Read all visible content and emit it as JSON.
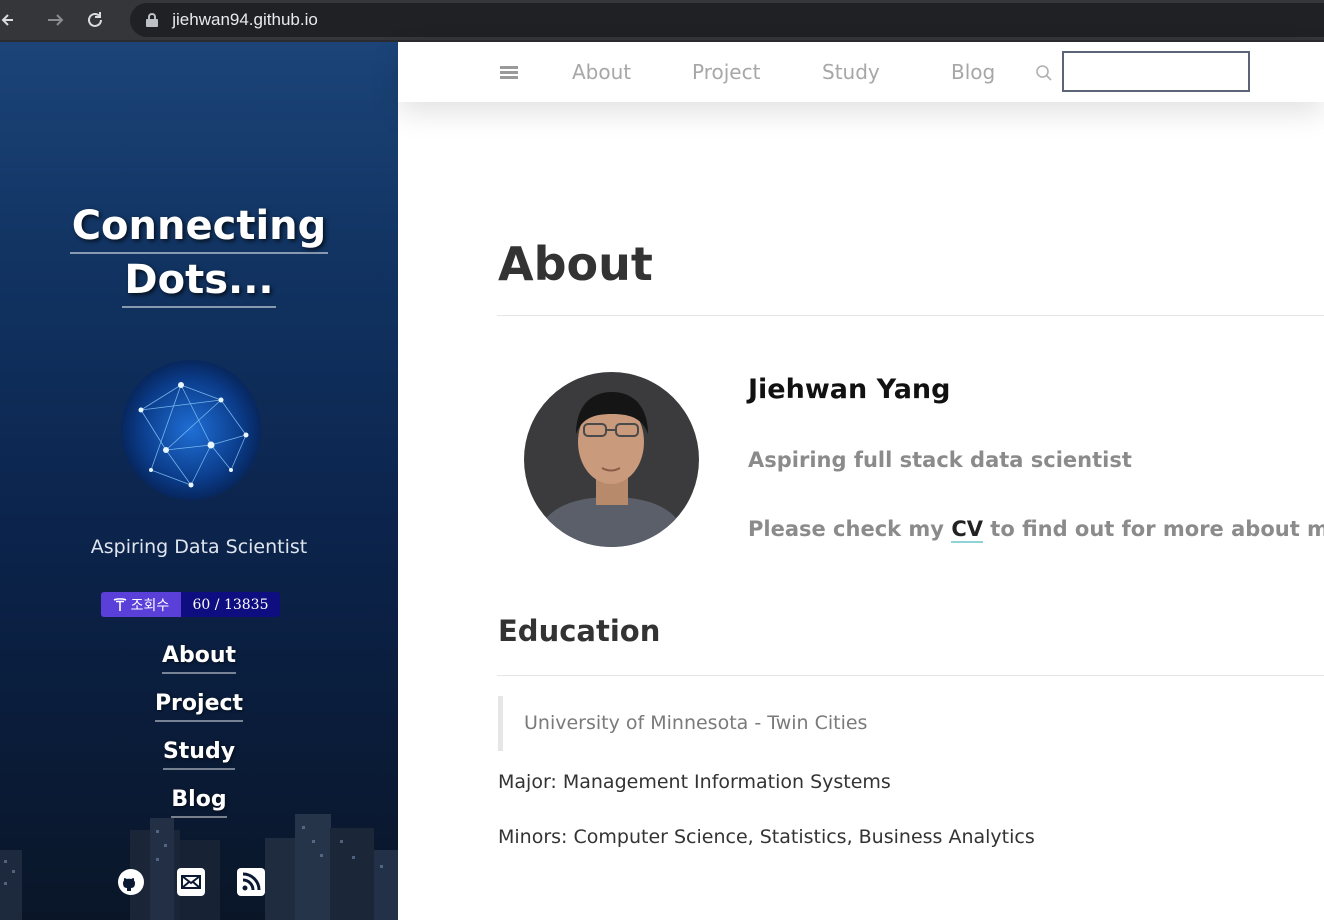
{
  "browser": {
    "url": "jiehwan94.github.io"
  },
  "sidebar": {
    "title_line1": "Connecting",
    "title_line2": "Dots...",
    "tagline": "Aspiring Data Scientist",
    "hits": {
      "label": "조회수",
      "count": "60 / 13835"
    },
    "nav": [
      "About",
      "Project",
      "Study",
      "Blog"
    ],
    "social_icons": [
      "github-icon",
      "email-icon",
      "rss-icon"
    ]
  },
  "topnav": {
    "links": [
      "About",
      "Project",
      "Study",
      "Blog"
    ],
    "search_value": ""
  },
  "main": {
    "page_title": "About",
    "name": "Jiehwan Yang",
    "headline": "Aspiring full stack data scientist",
    "cv_prefix": "Please check my",
    "cv_link": "CV",
    "cv_suffix": "to find out for more about me!",
    "education": {
      "title": "Education",
      "school": "University of Minnesota - Twin Cities",
      "major": "Major: Management Information Systems",
      "minors": "Minors: Computer Science, Statistics, Business Analytics"
    }
  },
  "colors": {
    "sidebar_top": "#1c4479",
    "sidebar_bottom": "#0a1628",
    "hits_label_bg": "#5b3fd9",
    "hits_count_bg": "#0e0e80",
    "link_underline": "#8fd3d8"
  }
}
